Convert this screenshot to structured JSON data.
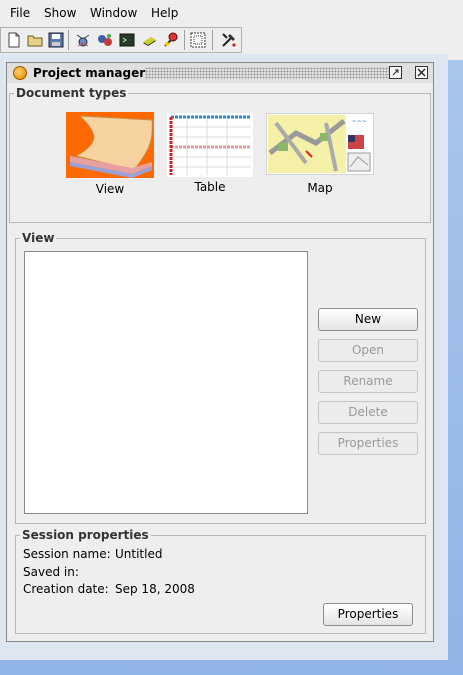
{
  "menubar": {
    "items": [
      "File",
      "Show",
      "Window",
      "Help"
    ]
  },
  "toolbar": {
    "icons": [
      "new-document-icon",
      "open-folder-icon",
      "save-disk-icon",
      "add-layer-icon",
      "add-view-icon",
      "terminal-icon",
      "table-icon",
      "map-pin-icon",
      "selection-icon",
      "tools-icon"
    ]
  },
  "frame": {
    "title": "Project manager"
  },
  "document_types": {
    "legend": "Document types",
    "items": [
      {
        "label": "View"
      },
      {
        "label": "Table"
      },
      {
        "label": "Map"
      }
    ]
  },
  "view_panel": {
    "legend": "View",
    "buttons": {
      "new": "New",
      "open": "Open",
      "rename": "Rename",
      "delete": "Delete",
      "properties": "Properties"
    }
  },
  "session": {
    "legend": "Session properties",
    "name_label": "Session name:",
    "name_value": "Untitled",
    "saved_label": "Saved in:",
    "saved_value": "",
    "date_label": "Creation date:",
    "date_value": "Sep 18, 2008",
    "properties_button": "Properties"
  },
  "colors": {
    "desktop_blue": "#8fb4e6",
    "view_orange": "#ff6a00"
  }
}
